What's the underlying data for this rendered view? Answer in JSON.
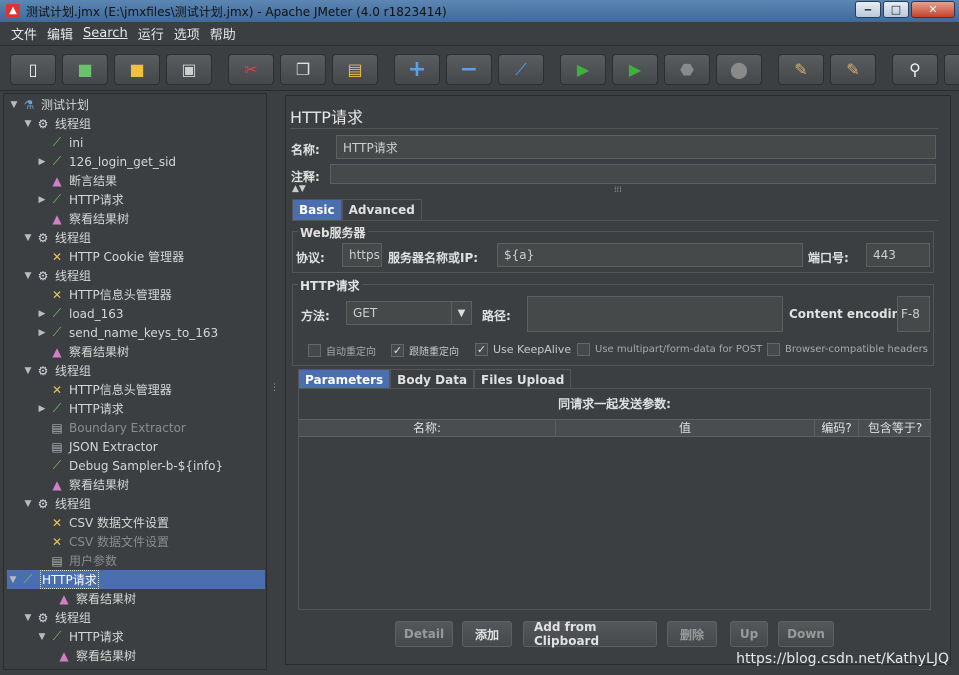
{
  "window": {
    "title": "测试计划.jmx (E:\\jmxfiles\\测试计划.jmx) - Apache JMeter (4.0 r1823414)",
    "min": "‒",
    "max": "□",
    "close": "✕"
  },
  "menu": [
    "文件",
    "编辑",
    "Search",
    "运行",
    "选项",
    "帮助"
  ],
  "toolbar_icons": [
    "new-icon",
    "templates-icon",
    "open-icon",
    "save-icon",
    "cut-icon",
    "copy-icon",
    "paste-icon",
    "expand-icon",
    "collapse-icon",
    "toggle-icon",
    "start-icon",
    "start-no-pauses-icon",
    "stop-icon",
    "shutdown-icon",
    "clear-icon",
    "clear-all-icon",
    "search-icon"
  ],
  "tree": [
    {
      "label": "测试计划",
      "icon": "test-plan-icon",
      "depth": 0,
      "toggle": "▼"
    },
    {
      "label": "线程组",
      "icon": "gear-icon",
      "depth": 1,
      "toggle": "▼"
    },
    {
      "label": "ini",
      "icon": "sampler-icon",
      "depth": 2,
      "toggle": ""
    },
    {
      "label": "126_login_get_sid",
      "icon": "sampler-icon",
      "depth": 2,
      "toggle": "▶"
    },
    {
      "label": "断言结果",
      "icon": "listener-icon",
      "depth": 2,
      "toggle": ""
    },
    {
      "label": "HTTP请求",
      "icon": "sampler-icon",
      "depth": 2,
      "toggle": "▶"
    },
    {
      "label": "察看结果树",
      "icon": "listener-icon",
      "depth": 2,
      "toggle": ""
    },
    {
      "label": "线程组",
      "icon": "gear-icon",
      "depth": 1,
      "toggle": "▼"
    },
    {
      "label": "HTTP Cookie 管理器",
      "icon": "config-icon",
      "depth": 2,
      "toggle": ""
    },
    {
      "label": "线程组",
      "icon": "gear-icon",
      "depth": 1,
      "toggle": "▼"
    },
    {
      "label": "HTTP信息头管理器",
      "icon": "config-icon",
      "depth": 2,
      "toggle": ""
    },
    {
      "label": "load_163",
      "icon": "sampler-icon",
      "depth": 2,
      "toggle": "▶"
    },
    {
      "label": "send_name_keys_to_163",
      "icon": "sampler-icon",
      "depth": 2,
      "toggle": "▶"
    },
    {
      "label": "察看结果树",
      "icon": "listener-icon",
      "depth": 2,
      "toggle": ""
    },
    {
      "label": "线程组",
      "icon": "gear-icon",
      "depth": 1,
      "toggle": "▼"
    },
    {
      "label": "HTTP信息头管理器",
      "icon": "config-icon",
      "depth": 2,
      "toggle": ""
    },
    {
      "label": "HTTP请求",
      "icon": "sampler-icon",
      "depth": 2,
      "toggle": "▶"
    },
    {
      "label": "Boundary Extractor",
      "icon": "extractor-icon",
      "depth": 2,
      "toggle": "",
      "dim": true
    },
    {
      "label": "JSON Extractor",
      "icon": "extractor-icon",
      "depth": 2,
      "toggle": ""
    },
    {
      "label": "Debug Sampler-b-${info}",
      "icon": "sampler-icon",
      "depth": 2,
      "toggle": ""
    },
    {
      "label": "察看结果树",
      "icon": "listener-icon",
      "depth": 2,
      "toggle": ""
    },
    {
      "label": "线程组",
      "icon": "gear-icon",
      "depth": 1,
      "toggle": "▼"
    },
    {
      "label": "CSV 数据文件设置",
      "icon": "config-icon",
      "depth": 2,
      "toggle": ""
    },
    {
      "label": "CSV 数据文件设置",
      "icon": "config-icon",
      "depth": 2,
      "toggle": "",
      "dim": true
    },
    {
      "label": "用户参数",
      "icon": "preprocessor-icon",
      "depth": 2,
      "toggle": "",
      "dim": true
    },
    {
      "label": "HTTP请求",
      "icon": "sampler-icon",
      "depth": 2,
      "toggle": "▼",
      "selected": true
    },
    {
      "label": "察看结果树",
      "icon": "listener-icon",
      "depth": 3,
      "toggle": ""
    },
    {
      "label": "线程组",
      "icon": "gear-icon",
      "depth": 1,
      "toggle": "▼"
    },
    {
      "label": "HTTP请求",
      "icon": "sampler-icon",
      "depth": 2,
      "toggle": "▼"
    },
    {
      "label": "察看结果树",
      "icon": "listener-icon",
      "depth": 3,
      "toggle": ""
    }
  ],
  "panel": {
    "title": "HTTP请求",
    "name_label": "名称:",
    "name_value": "HTTP请求",
    "comment_label": "注释:",
    "comment_value": "",
    "tabs": [
      "Basic",
      "Advanced"
    ],
    "web_server": {
      "title": "Web服务器",
      "protocol_label": "协议:",
      "protocol_value": "https",
      "server_label": "服务器名称或IP:",
      "server_value": "${a}",
      "port_label": "端口号:",
      "port_value": "443"
    },
    "http_request": {
      "title": "HTTP请求",
      "method_label": "方法:",
      "method_value": "GET",
      "path_label": "路径:",
      "path_value": "",
      "encoding_label": "Content encoding:",
      "encoding_value": "F-8",
      "checkboxes": [
        {
          "label": "自动重定向",
          "checked": false
        },
        {
          "label": "跟随重定向",
          "checked": true
        },
        {
          "label": "Use KeepAlive",
          "checked": true
        },
        {
          "label": "Use multipart/form-data for POST",
          "checked": false
        },
        {
          "label": "Browser-compatible headers",
          "checked": false
        }
      ]
    },
    "sub_tabs": [
      "Parameters",
      "Body Data",
      "Files Upload"
    ],
    "table": {
      "caption": "同请求一起发送参数:",
      "columns": [
        "名称:",
        "值",
        "编码?",
        "包含等于?"
      ]
    },
    "buttons": [
      "Detail",
      "添加",
      "Add from Clipboard",
      "删除",
      "Up",
      "Down"
    ]
  },
  "watermark": "https://blog.csdn.net/KathyLJQ"
}
